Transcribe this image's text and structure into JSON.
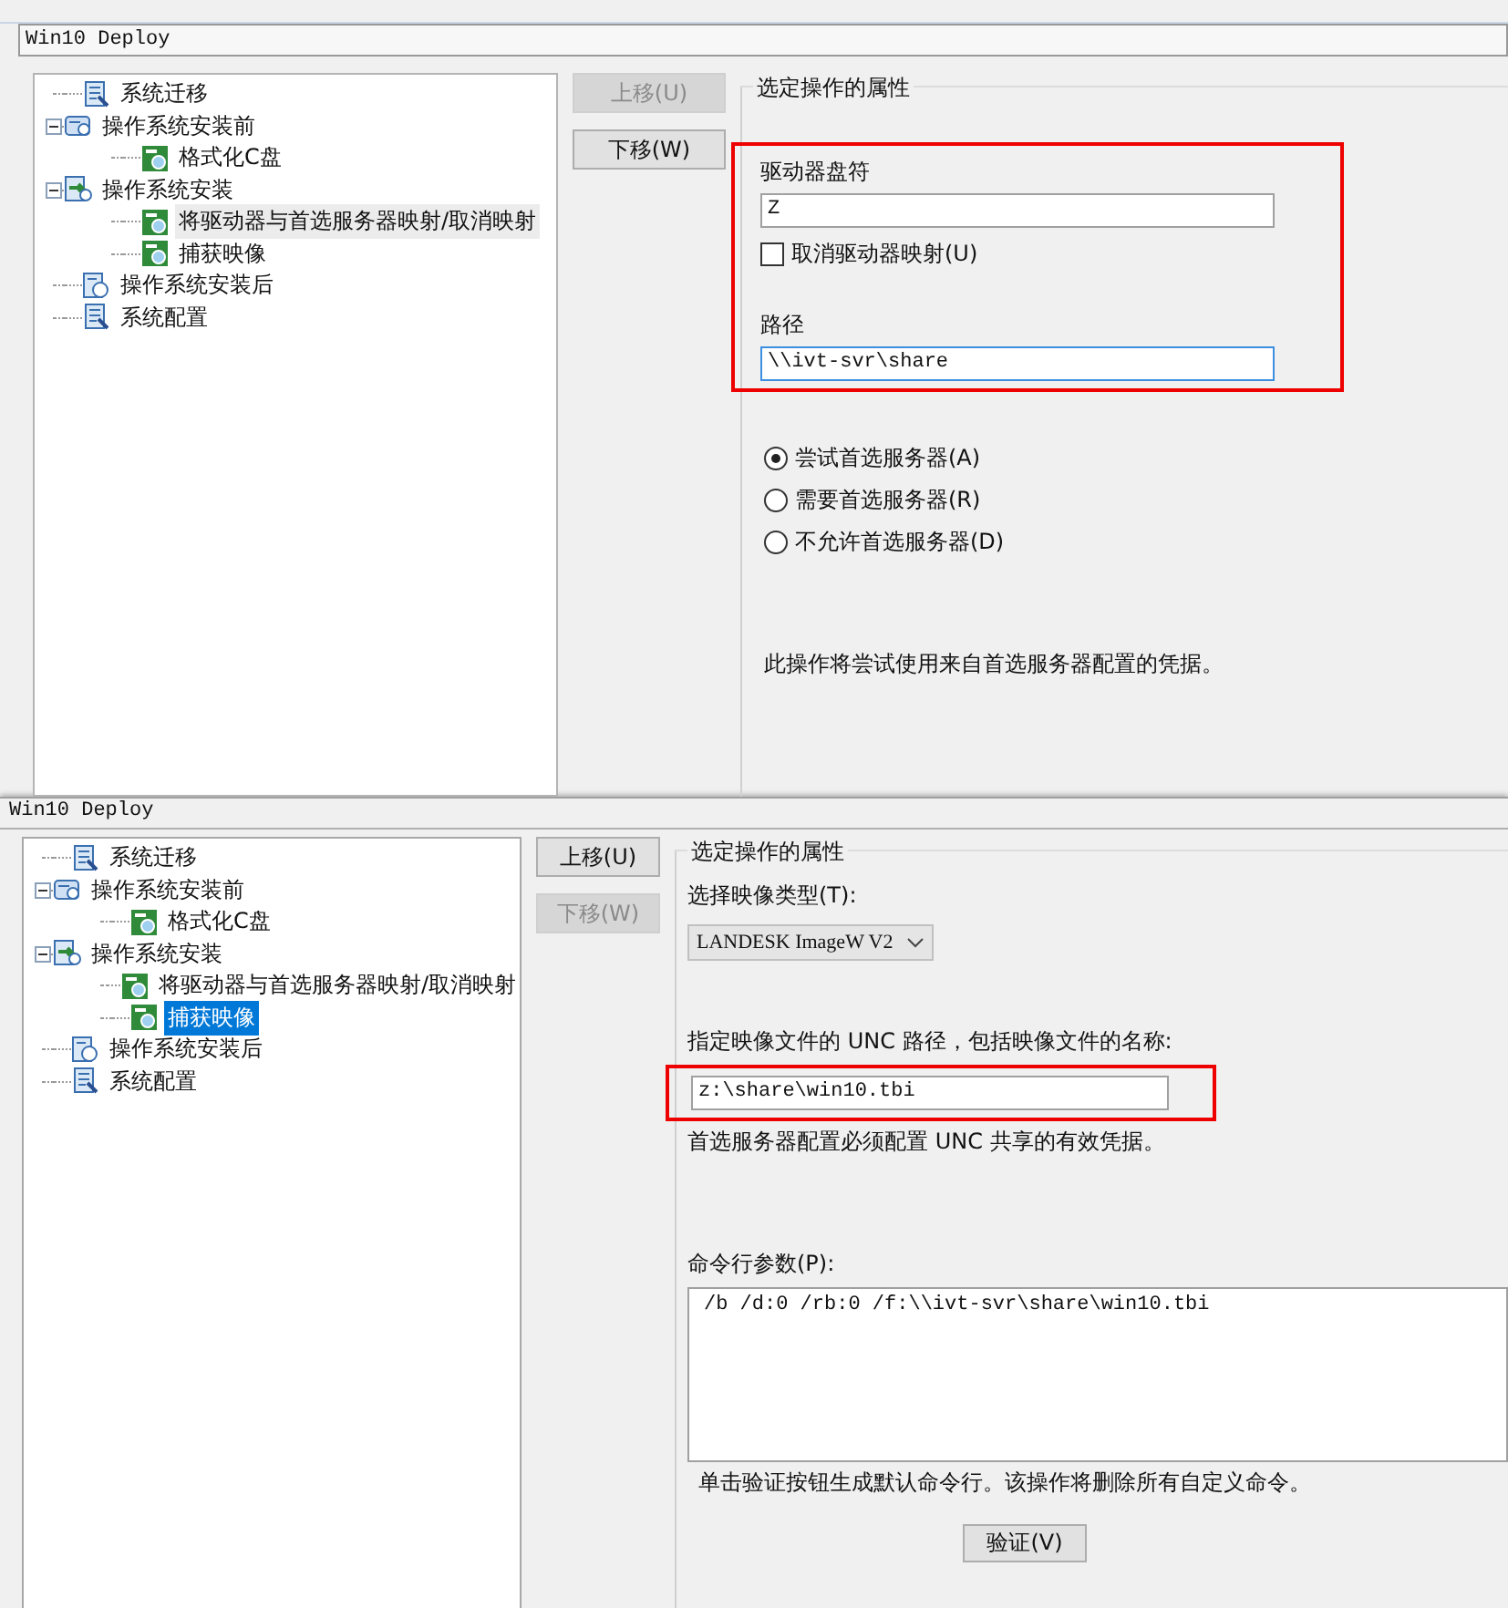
{
  "panels": [
    {
      "title": "Win10 Deploy",
      "active": false,
      "tree": [
        {
          "label": "系统迁移",
          "kind": "scroll",
          "selected": false
        },
        {
          "label": "操作系统安装前",
          "kind": "disk",
          "selected": false,
          "expanded": true,
          "children": [
            {
              "label": "格式化C盘",
              "kind": "gear",
              "selected": false
            }
          ]
        },
        {
          "label": "操作系统安装",
          "kind": "install",
          "selected": false,
          "expanded": true,
          "children": [
            {
              "label": "将驱动器与首选服务器映射/取消映射",
              "kind": "gear",
              "selected": true
            },
            {
              "label": "捕获映像",
              "kind": "gear",
              "selected": false
            }
          ]
        },
        {
          "label": "操作系统安装后",
          "kind": "post",
          "selected": false
        },
        {
          "label": "系统配置",
          "kind": "scroll",
          "selected": false
        }
      ],
      "buttons": [
        {
          "label": "上移(U)",
          "disabled": true
        },
        {
          "label": "下移(W)",
          "disabled": false
        }
      ],
      "group_title": "选定操作的属性",
      "properties": [
        {
          "kind": "highlight",
          "children": [
            {
              "kind": "label",
              "text": "驱动器盘符"
            },
            {
              "kind": "field",
              "value": "Z",
              "focused": false
            },
            {
              "kind": "checkbox",
              "text": "取消驱动器映射(U)",
              "checked": false
            },
            {
              "kind": "label",
              "text": "路径"
            },
            {
              "kind": "field",
              "value": "\\\\ivt-svr\\share",
              "focused": true
            }
          ]
        },
        {
          "kind": "radios",
          "options": [
            {
              "text": "尝试首选服务器(A)",
              "selected": true
            },
            {
              "text": "需要首选服务器(R)",
              "selected": false
            },
            {
              "text": "不允许首选服务器(D)",
              "selected": false
            }
          ]
        },
        {
          "kind": "note",
          "text": "此操作将尝试使用来自首选服务器配置的凭据。"
        }
      ]
    },
    {
      "title": "Win10 Deploy",
      "active": true,
      "tree": [
        {
          "label": "系统迁移",
          "kind": "scroll",
          "selected": false
        },
        {
          "label": "操作系统安装前",
          "kind": "disk",
          "selected": false,
          "expanded": true,
          "children": [
            {
              "label": "格式化C盘",
              "kind": "gear",
              "selected": false
            }
          ]
        },
        {
          "label": "操作系统安装",
          "kind": "install",
          "selected": false,
          "expanded": true,
          "children": [
            {
              "label": "将驱动器与首选服务器映射/取消映射",
              "kind": "gear",
              "selected": false
            },
            {
              "label": "捕获映像",
              "kind": "gear",
              "selected": true
            }
          ]
        },
        {
          "label": "操作系统安装后",
          "kind": "post",
          "selected": false
        },
        {
          "label": "系统配置",
          "kind": "scroll",
          "selected": false
        }
      ],
      "buttons": [
        {
          "label": "上移(U)",
          "disabled": false
        },
        {
          "label": "下移(W)",
          "disabled": true
        }
      ],
      "group_title": "选定操作的属性",
      "properties": [
        {
          "kind": "label",
          "text": "选择映像类型(T):"
        },
        {
          "kind": "dropdown",
          "value": "LANDESK ImageW V2"
        },
        {
          "kind": "label",
          "text": "指定映像文件的 UNC 路径，包括映像文件的名称:"
        },
        {
          "kind": "highlight",
          "children": [
            {
              "kind": "field",
              "value": "z:\\share\\win10.tbi",
              "focused": false
            }
          ]
        },
        {
          "kind": "hint",
          "text": "首选服务器配置必须配置 UNC 共享的有效凭据。"
        },
        {
          "kind": "label",
          "text": "命令行参数(P):"
        },
        {
          "kind": "textarea",
          "value": "/b /d:0 /rb:0 /f:\\\\ivt-svr\\share\\win10.tbi"
        },
        {
          "kind": "hint",
          "text": "单击验证按钮生成默认命令行。该操作将删除所有自定义命令。"
        },
        {
          "kind": "button",
          "text": "验证(V)"
        }
      ]
    }
  ]
}
